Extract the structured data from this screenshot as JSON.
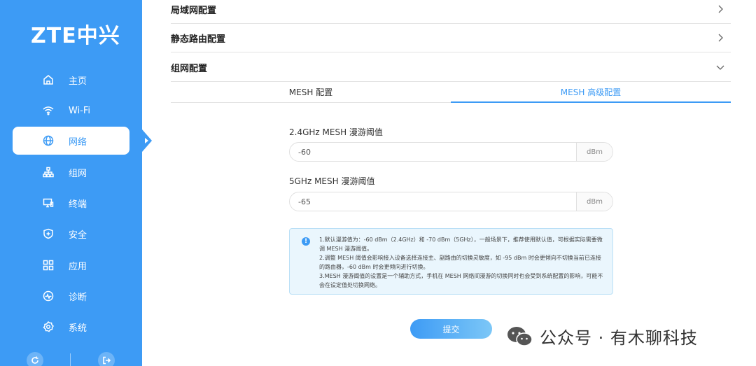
{
  "brand": {
    "logo": "ZTE中兴"
  },
  "sidebar": {
    "items": [
      {
        "label": "主页",
        "icon": "home-icon"
      },
      {
        "label": "Wi-Fi",
        "icon": "wifi-icon"
      },
      {
        "label": "网络",
        "icon": "globe-icon",
        "active": true
      },
      {
        "label": "组网",
        "icon": "network-icon"
      },
      {
        "label": "终端",
        "icon": "monitor-icon"
      },
      {
        "label": "安全",
        "icon": "shield-icon"
      },
      {
        "label": "应用",
        "icon": "apps-icon"
      },
      {
        "label": "诊断",
        "icon": "diagnosis-icon"
      },
      {
        "label": "系统",
        "icon": "gear-icon"
      }
    ],
    "bottom": {
      "left_icon": "refresh-icon",
      "right_icon": "logout-icon"
    }
  },
  "sections": {
    "lan": "局域网配置",
    "static_route": "静态路由配置",
    "mesh": "组网配置"
  },
  "tabs": [
    {
      "label": "MESH 配置"
    },
    {
      "label": "MESH 高级配置",
      "active": true
    }
  ],
  "form": {
    "field_24": {
      "label": "2.4GHz MESH 漫游阈值",
      "value": "-60",
      "unit": "dBm"
    },
    "field_5": {
      "label": "5GHz MESH 漫游阈值",
      "value": "-65",
      "unit": "dBm"
    }
  },
  "info": {
    "line1": "1.默认漫游值为：-60 dBm（2.4GHz）和 -70 dBm（5GHz），一般场景下，推荐使用默认值，可根据实际需要微调 MESH 漫游阈值。",
    "line2": "2.调整 MESH 阈值会影响接入设备选择连接主、副路由的切换灵敏度，如 -95 dBm 时会更倾向不切换当前已连接的路由器，-60 dBm 时会更倾向进行切换。",
    "line3": "3.MESH 漫游阈值的设置是一个辅助方式，手机在 MESH 网络间漫游的切换同时也会受到系统配置的影响，可能不会在设定值处切换网络。"
  },
  "submit_label": "提交",
  "watermark": "公众号 · 有木聊科技",
  "colors": {
    "primary": "#3d9bf5",
    "info_bg": "#eaf6fd"
  }
}
